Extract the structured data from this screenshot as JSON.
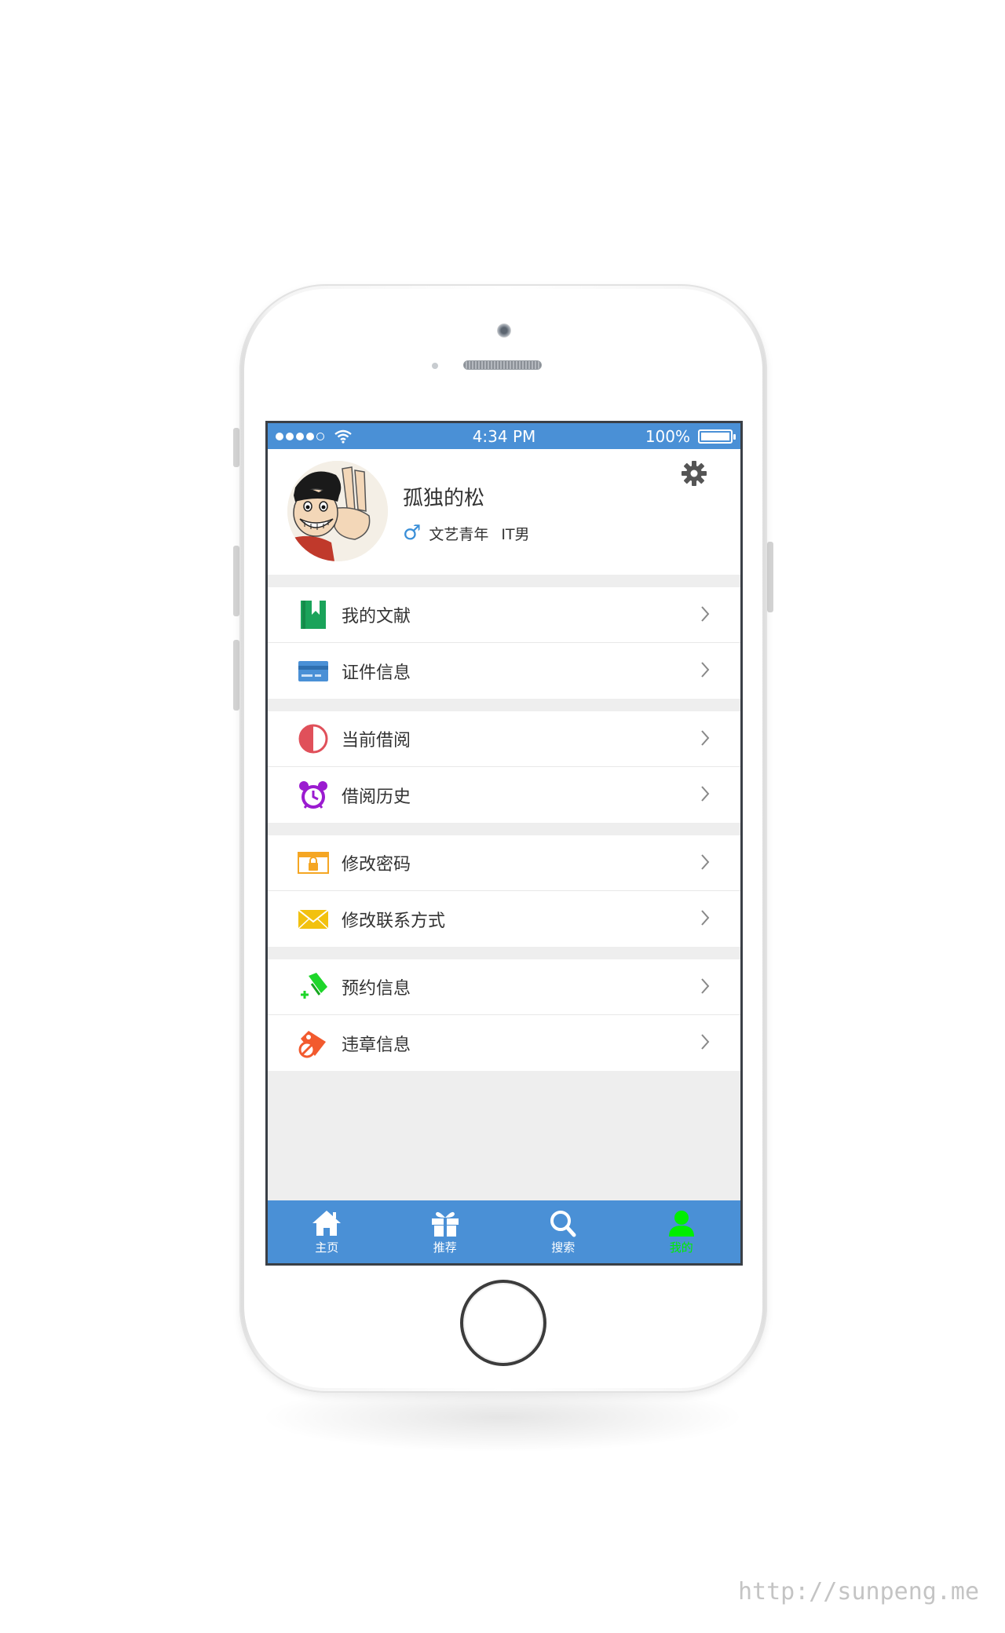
{
  "status_bar": {
    "time": "4:34 PM",
    "battery": "100%"
  },
  "profile": {
    "name": "孤独的松",
    "gender_symbol": "♂",
    "tag1": "文艺青年",
    "tag2": "IT男"
  },
  "menu_groups": [
    {
      "items": [
        {
          "label": "我的文献",
          "icon": "bookmark-book-icon",
          "color": "#1aa35a"
        },
        {
          "label": "证件信息",
          "icon": "id-card-icon",
          "color": "#4a90d6"
        }
      ]
    },
    {
      "items": [
        {
          "label": "当前借阅",
          "icon": "half-circle-icon",
          "color": "#e0505a"
        },
        {
          "label": "借阅历史",
          "icon": "alarm-clock-icon",
          "color": "#9b1bd0"
        }
      ]
    },
    {
      "items": [
        {
          "label": "修改密码",
          "icon": "lock-folder-icon",
          "color": "#f5a623"
        },
        {
          "label": "修改联系方式",
          "icon": "envelope-icon",
          "color": "#f2c10f"
        }
      ]
    },
    {
      "items": [
        {
          "label": "预约信息",
          "icon": "pin-plus-icon",
          "color": "#1ed62a"
        },
        {
          "label": "违章信息",
          "icon": "tag-forbidden-icon",
          "color": "#f25a2e"
        }
      ]
    }
  ],
  "tabbar": {
    "tabs": [
      {
        "label": "主页",
        "icon": "home-icon"
      },
      {
        "label": "推荐",
        "icon": "gift-icon"
      },
      {
        "label": "搜索",
        "icon": "search-icon"
      },
      {
        "label": "我的",
        "icon": "user-icon",
        "active": true
      }
    ],
    "active_color": "#00ee00"
  },
  "watermark": "http://sunpeng.me",
  "colors": {
    "accent": "#4a90d6",
    "background": "#eeeeee"
  }
}
